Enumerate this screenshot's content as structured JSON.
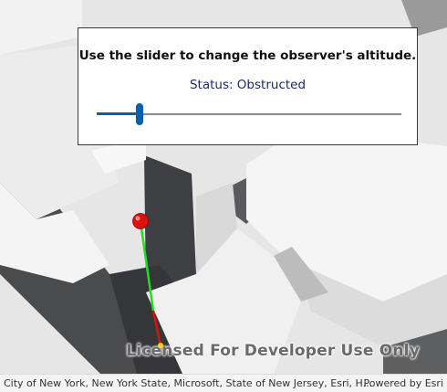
{
  "panel": {
    "title": "Use the slider to change the observer's altitude.",
    "status": "Status: Obstructed",
    "slider_value": 0.14
  },
  "map": {
    "watermark": "Licensed For Developer Use Only",
    "attribution": "City of New York, New York State, Microsoft, State of New Jersey, Esri, H...",
    "powered_by": "Powered by Esri"
  },
  "colors": {
    "accent": "#0a5fa8",
    "observer": "#e01010",
    "visible_line": "#22dd22",
    "obstructed_line": "#dd1111",
    "status_text": "#1b2a6b"
  }
}
